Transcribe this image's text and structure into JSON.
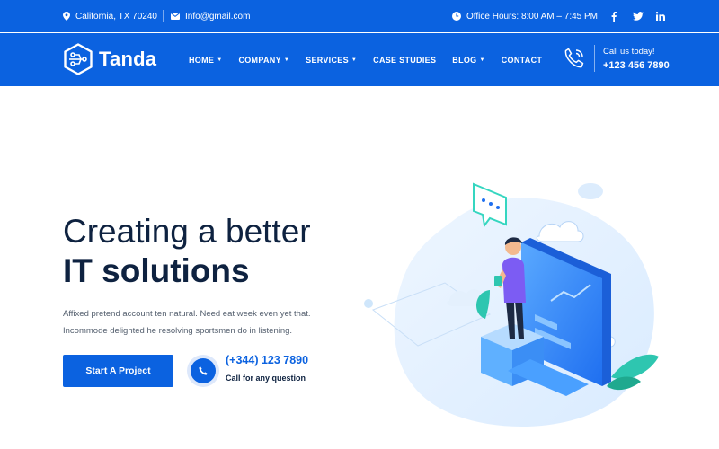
{
  "topbar": {
    "location": "California, TX 70240",
    "email": "Info@gmail.com",
    "office_hours": "Office Hours: 8:00 AM – 7:45 PM",
    "social": [
      "f",
      "twitter",
      "in"
    ]
  },
  "navbar": {
    "brand": "Tanda",
    "menu": [
      {
        "label": "HOME",
        "dropdown": true
      },
      {
        "label": "COMPANY",
        "dropdown": true
      },
      {
        "label": "SERVICES",
        "dropdown": true
      },
      {
        "label": "CASE STUDIES",
        "dropdown": false
      },
      {
        "label": "BLOG",
        "dropdown": true
      },
      {
        "label": "CONTACT",
        "dropdown": false
      }
    ],
    "call_label": "Call us today!",
    "call_phone": "+123 456 7890"
  },
  "hero": {
    "title_line1": "Creating a better",
    "title_line2": "IT solutions",
    "description_line1": "Affixed pretend account ten natural. Need eat week even yet that.",
    "description_line2": "Incommode delighted he resolving sportsmen do in listening.",
    "cta_label": "Start A Project",
    "phone": "(+344) 123 7890",
    "phone_caption": "Call for any question"
  },
  "colors": {
    "brand_blue": "#0b62e0",
    "dark_text": "#0e2240",
    "accent_teal": "#2ec6b0"
  }
}
